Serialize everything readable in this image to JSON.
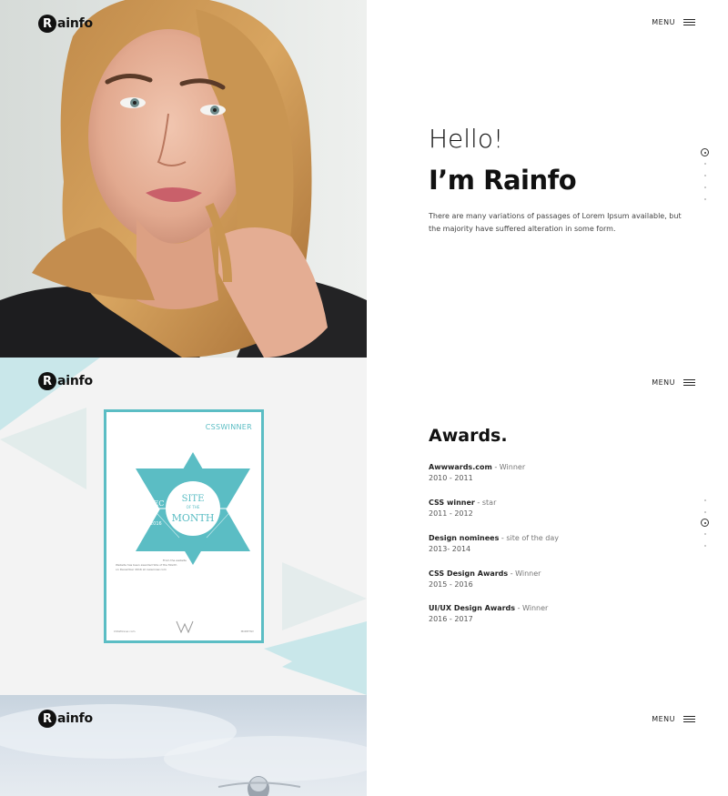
{
  "brand": {
    "logo_letter": "R",
    "logo_text": "ainfo"
  },
  "nav": {
    "menu_label": "MENU"
  },
  "hero": {
    "greeting": "Hello!",
    "name": "I’m Rainfo",
    "intro_line1": "There are many variations of passages of Lorem Ipsum available, but",
    "intro_line2": "the majority have suffered alteration in some form."
  },
  "awards": {
    "title": "Awards.",
    "items": [
      {
        "name": "Awwwards.com",
        "separator": " - ",
        "result": "Winner",
        "years": "2010 - 2011"
      },
      {
        "name": "CSS winner",
        "separator": " - ",
        "result": "star",
        "years": "2011 - 2012"
      },
      {
        "name": "Design nominees",
        "separator": " - ",
        "result": "site of the day",
        "years": "2013- 2014"
      },
      {
        "name": "CSS Design Awards",
        "separator": " - ",
        "result": "Winner",
        "years": "2015 - 2016"
      },
      {
        "name": "UI/UX Design Awards",
        "separator": " - ",
        "result": "Winner",
        "years": "2016 - 2017"
      }
    ]
  },
  "certificate": {
    "header": "CSSWINNER",
    "month": "DEC",
    "year": "2016",
    "line1": "SITE",
    "line2": "OF THE",
    "line3": "MONTH",
    "body_line1": "From the website",
    "body_line2": "Website has been awarded Site of the Month",
    "body_line3": "on December 2016 at csswinner.com",
    "foot_left": "CSSWinner.com",
    "foot_right": "MONTHLY"
  },
  "colors": {
    "accent": "#5bbdc4",
    "accent_light": "#c9e7ea",
    "text": "#111111"
  },
  "icons": {
    "menu": "hamburger-icon",
    "nav_dot": "dot-icon",
    "nav_active": "target-icon"
  }
}
